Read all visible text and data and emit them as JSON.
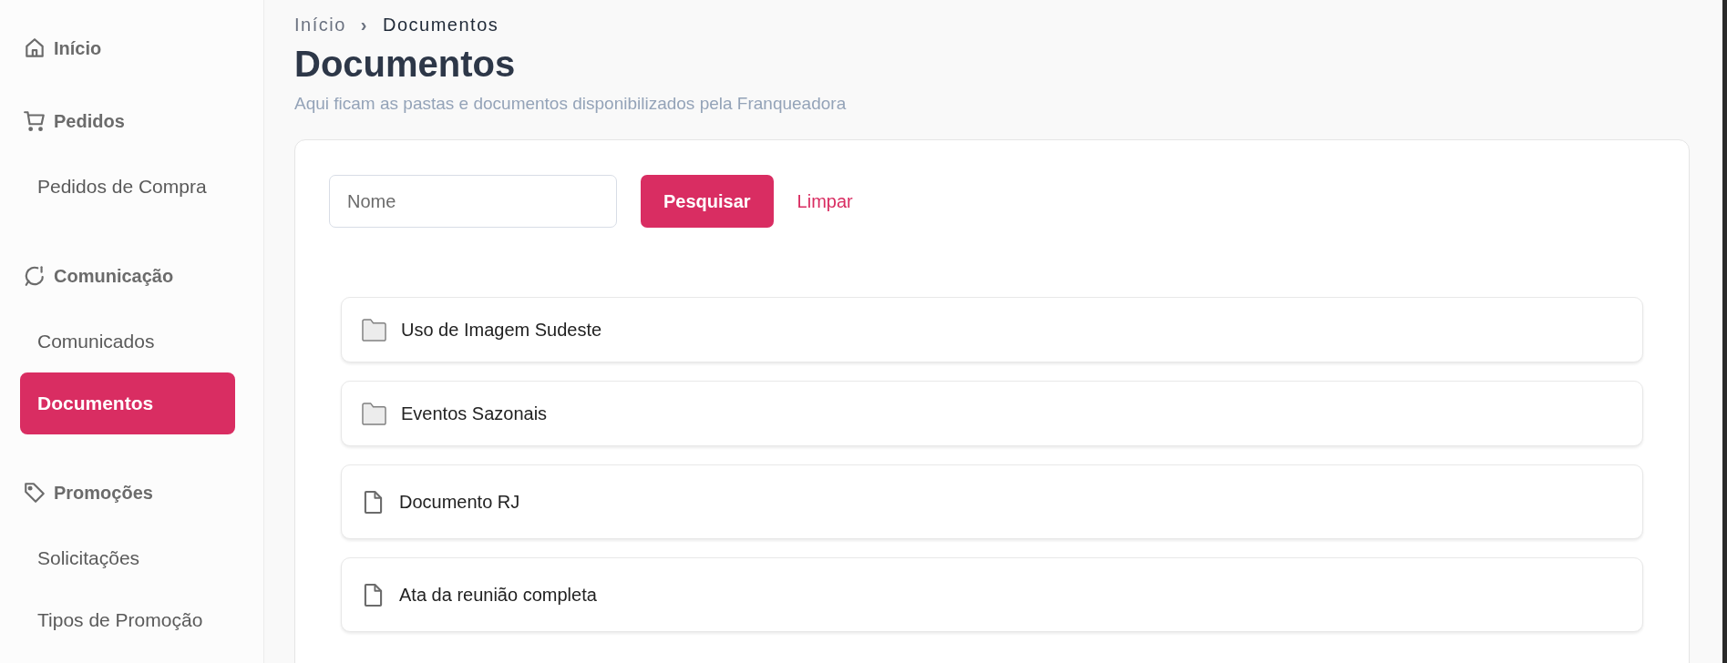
{
  "sidebar": {
    "sections": [
      {
        "title": "Início",
        "kind": "home"
      },
      {
        "title": "Pedidos",
        "kind": "cart",
        "items": [
          {
            "label": "Pedidos de Compra",
            "selected": false
          }
        ]
      },
      {
        "title": "Comunicação",
        "kind": "chat",
        "items": [
          {
            "label": "Comunicados",
            "selected": false
          },
          {
            "label": "Documentos",
            "selected": true
          }
        ]
      },
      {
        "title": "Promoções",
        "kind": "tag",
        "items": [
          {
            "label": "Solicitações",
            "selected": false
          },
          {
            "label": "Tipos de Promoção",
            "selected": false
          }
        ]
      }
    ]
  },
  "breadcrumb": {
    "separator": "›",
    "items": [
      "Início",
      "Documentos"
    ]
  },
  "page": {
    "title": "Documentos",
    "subtitle": "Aqui ficam as pastas e documentos disponibilizados pela Franqueadora"
  },
  "search": {
    "placeholder": "Nome",
    "button": "Pesquisar",
    "clear": "Limpar"
  },
  "documents": [
    {
      "kind": "folder",
      "name": "Uso de Imagem Sudeste"
    },
    {
      "kind": "folder",
      "name": "Eventos Sazonais"
    },
    {
      "kind": "file",
      "name": "Documento RJ"
    },
    {
      "kind": "file",
      "name": "Ata da reunião completa"
    }
  ]
}
